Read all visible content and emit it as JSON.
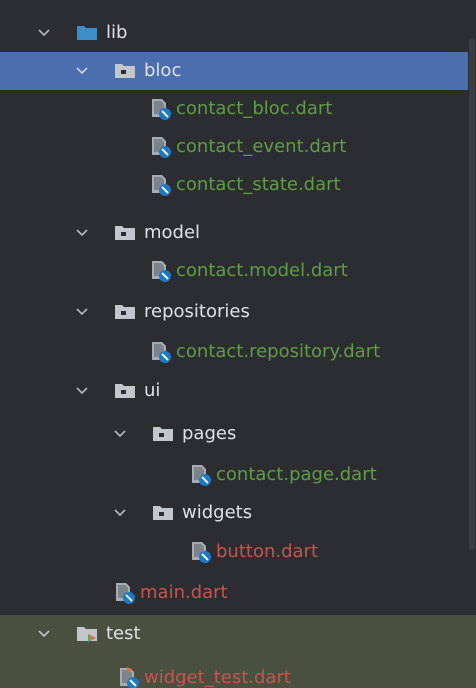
{
  "tree": {
    "lib": {
      "label": "lib",
      "icon": "folder-icon"
    },
    "bloc": {
      "label": "bloc",
      "icon": "package-folder-icon"
    },
    "contact_bloc": {
      "label": "contact_bloc.dart",
      "icon": "dart-file-icon"
    },
    "contact_event": {
      "label": "contact_event.dart",
      "icon": "dart-file-icon"
    },
    "contact_state": {
      "label": "contact_state.dart",
      "icon": "dart-file-icon"
    },
    "model": {
      "label": "model",
      "icon": "package-folder-icon"
    },
    "contact_model": {
      "label": "contact.model.dart",
      "icon": "dart-file-icon"
    },
    "repositories": {
      "label": "repositories",
      "icon": "package-folder-icon"
    },
    "contact_repository": {
      "label": "contact.repository.dart",
      "icon": "dart-file-icon"
    },
    "ui": {
      "label": "ui",
      "icon": "package-folder-icon"
    },
    "pages": {
      "label": "pages",
      "icon": "package-folder-icon"
    },
    "contact_page": {
      "label": "contact.page.dart",
      "icon": "dart-file-icon"
    },
    "widgets": {
      "label": "widgets",
      "icon": "package-folder-icon"
    },
    "button": {
      "label": "button.dart",
      "icon": "dart-file-icon"
    },
    "main": {
      "label": "main.dart",
      "icon": "dart-file-icon"
    },
    "test": {
      "label": "test",
      "icon": "test-folder-icon"
    },
    "widget_test": {
      "label": "widget_test.dart",
      "icon": "dart-test-file-icon"
    }
  },
  "colors": {
    "background": "#2b2d30",
    "selected": "#4b6eaf",
    "test_zone": "#49503f",
    "folder_text": "#dfe1e5",
    "added_file": "#5f9e45",
    "modified_file": "#c75450"
  }
}
